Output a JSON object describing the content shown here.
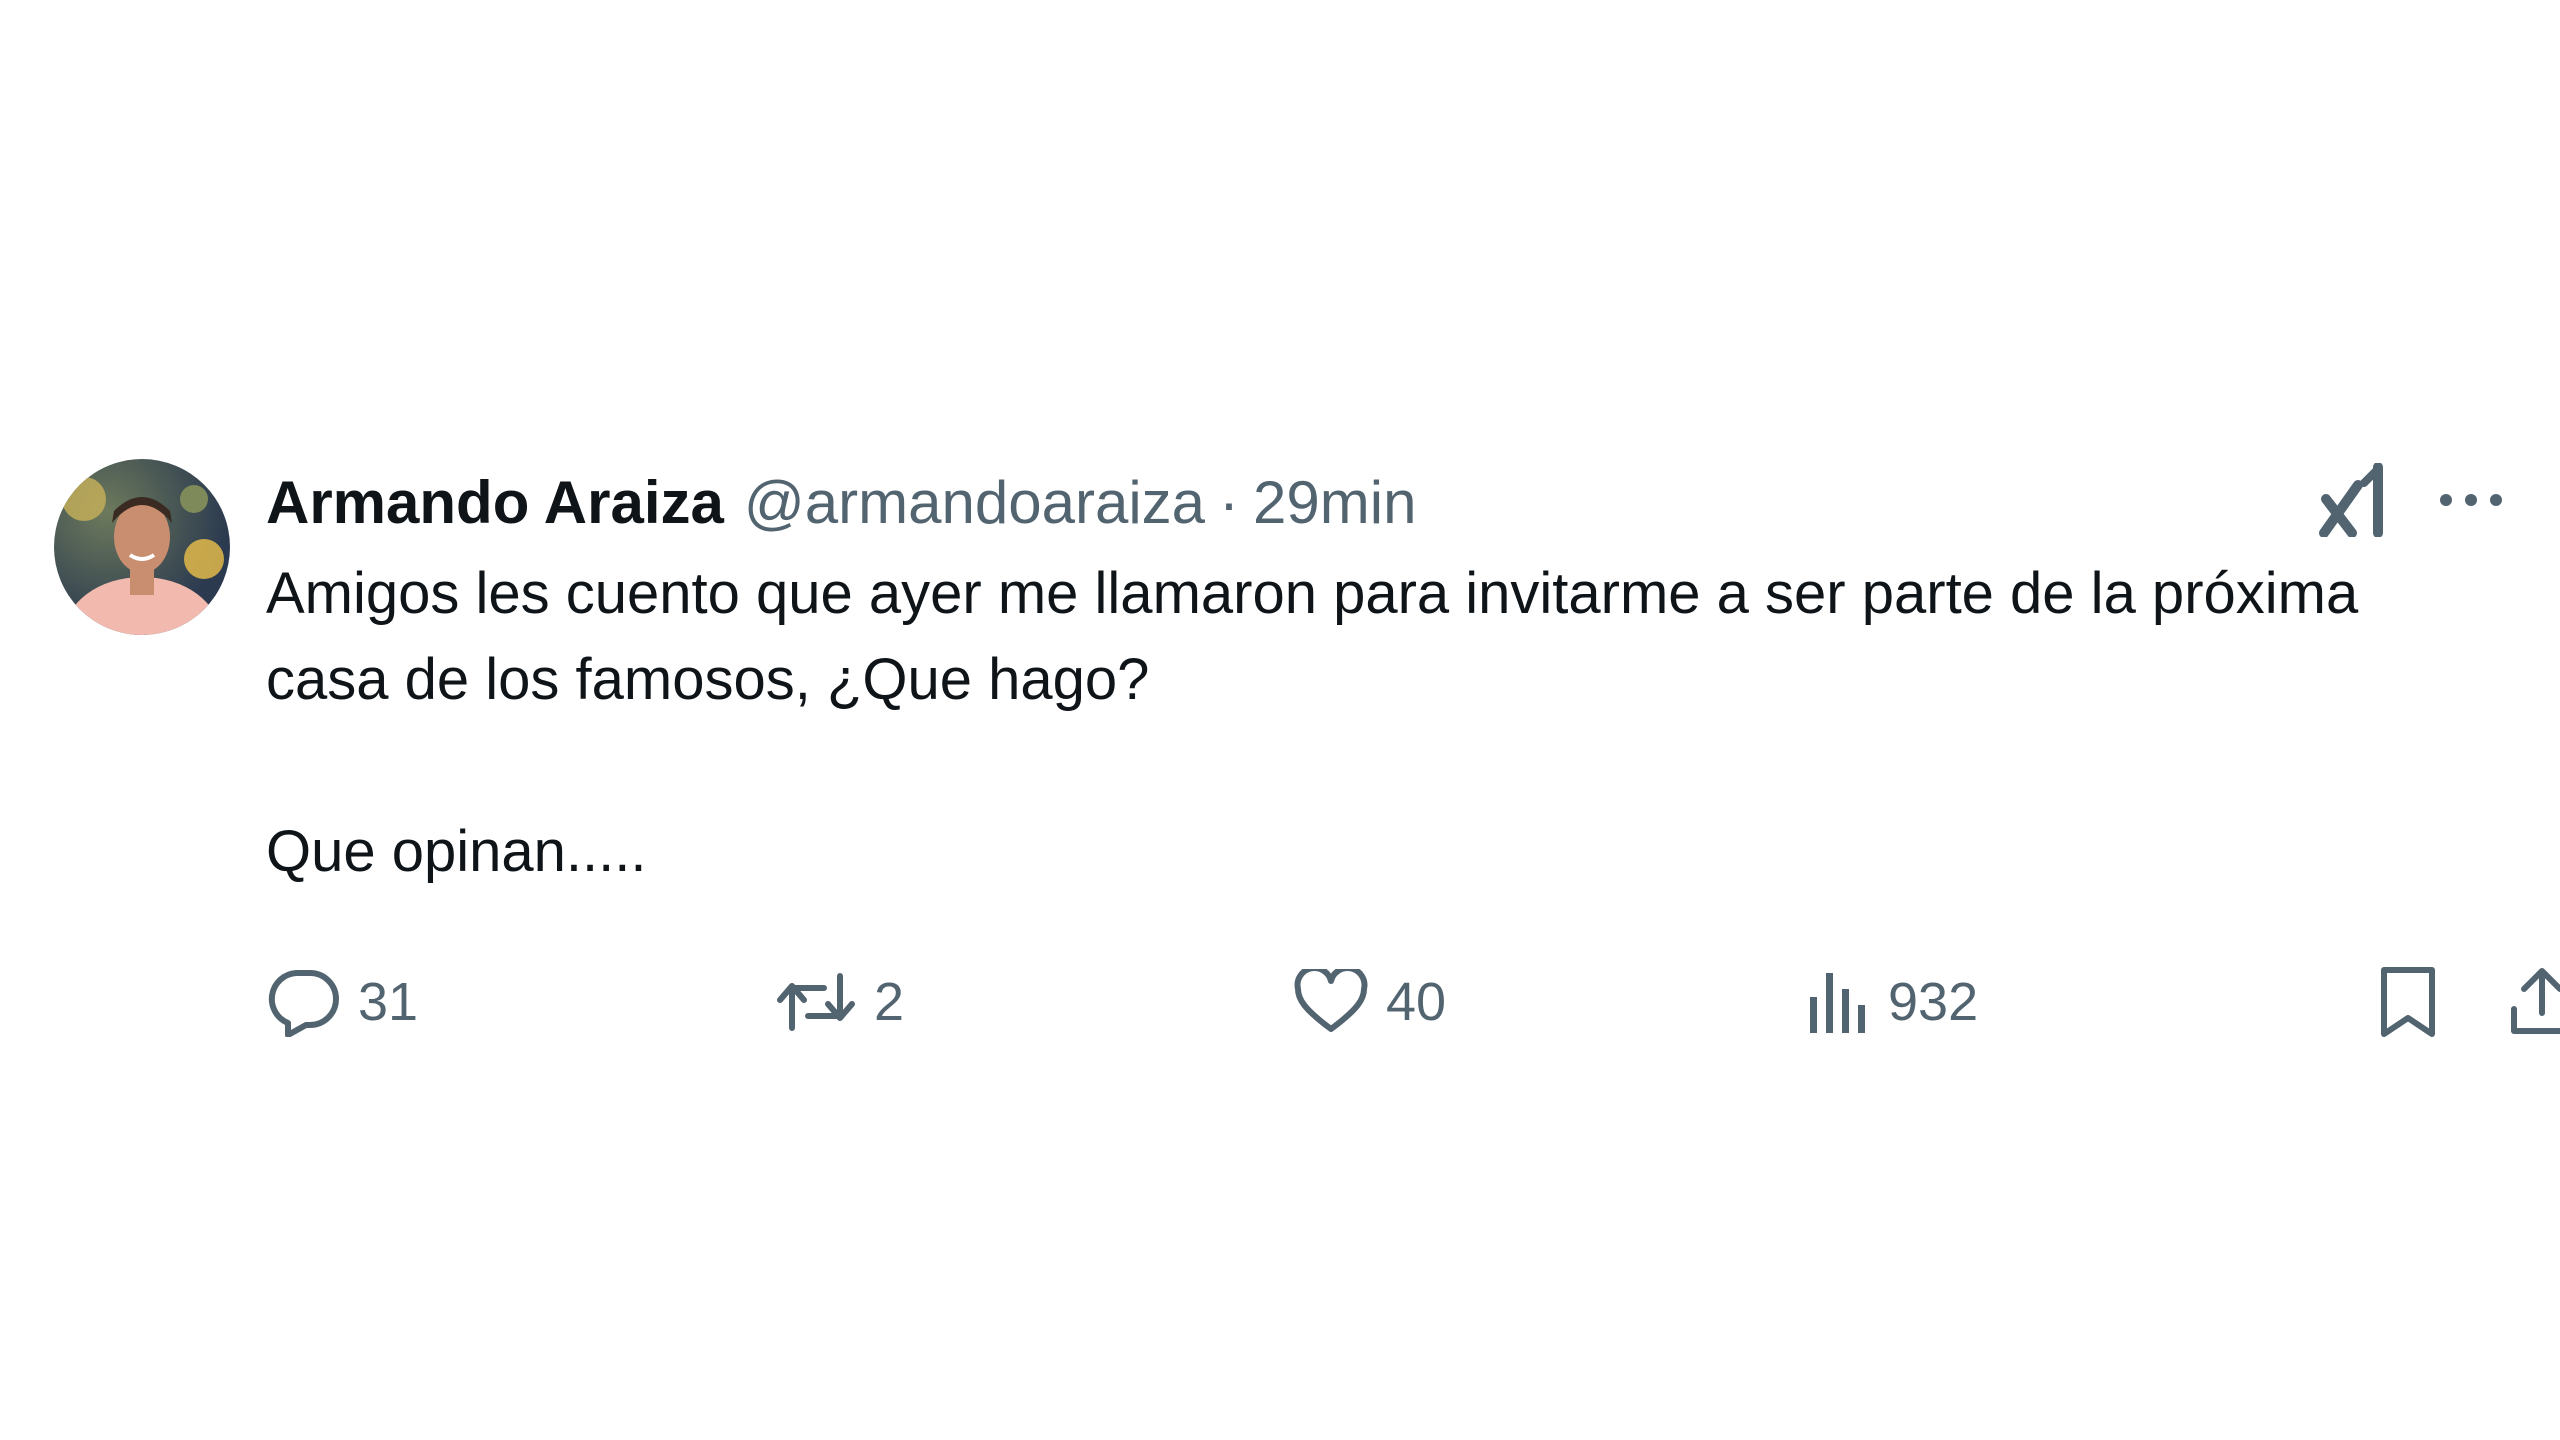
{
  "tweet": {
    "author_name": "Armando Araiza",
    "handle": "@armandoaraiza",
    "separator": "·",
    "time": "29min",
    "text": "Amigos les cuento que ayer me llamaron para invitarme a ser parte de la próxima casa de los famosos, ¿Que hago?\n\nQue opinan.....",
    "actions": {
      "replies": "31",
      "reposts": "2",
      "likes": "40",
      "views": "932"
    }
  },
  "icons": [
    "grok-icon",
    "more-icon",
    "reply-icon",
    "repost-icon",
    "like-icon",
    "views-icon",
    "bookmark-icon",
    "share-icon"
  ],
  "colors": {
    "text": "#0f1419",
    "muted": "#536471",
    "background": "#ffffff"
  }
}
